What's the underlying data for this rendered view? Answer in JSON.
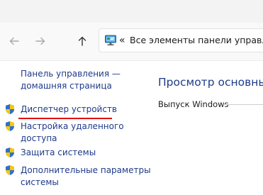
{
  "toolbar": {
    "back_icon": "arrow-left-icon",
    "forward_icon": "arrow-right-icon",
    "up_icon": "arrow-up-icon",
    "address": {
      "icon": "control-panel-icon",
      "chevrons": "«",
      "text": "Все элементы панели управлен..."
    }
  },
  "sidebar": {
    "home_link": {
      "line1": "Панель управления —",
      "line2": "домашняя страница"
    },
    "items": [
      {
        "icon": "uac-shield-icon",
        "line1": "Диспетчер устройств",
        "line2": ""
      },
      {
        "icon": "uac-shield-icon",
        "line1": "Настройка удаленного",
        "line2": "доступа"
      },
      {
        "icon": "uac-shield-icon",
        "line1": "Защита системы",
        "line2": ""
      },
      {
        "icon": "uac-shield-icon",
        "line1": "Дополнительные параметры",
        "line2": "системы"
      }
    ]
  },
  "main": {
    "heading": "Просмотр основных",
    "edition_label": "Выпуск Windows"
  },
  "colors": {
    "link": "#1e3b8a",
    "highlight_underline": "#e01010",
    "toolbar_bg": "#f9f9f9"
  }
}
